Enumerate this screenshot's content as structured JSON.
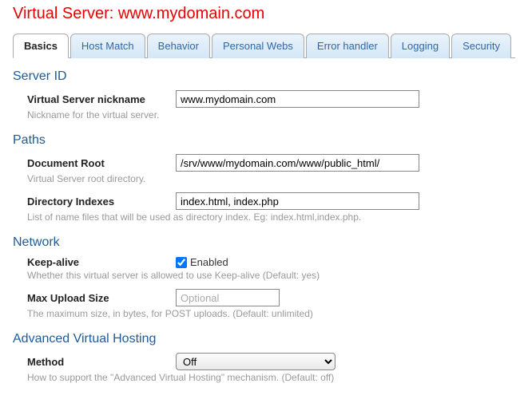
{
  "page_title": "Virtual Server: www.mydomain.com",
  "tabs": {
    "basics": "Basics",
    "host_match": "Host Match",
    "behavior": "Behavior",
    "personal_webs": "Personal Webs",
    "error_handler": "Error handler",
    "logging": "Logging",
    "security": "Security"
  },
  "sections": {
    "server_id": {
      "title": "Server ID",
      "nickname": {
        "label": "Virtual Server nickname",
        "value": "www.mydomain.com",
        "help": "Nickname for the virtual server."
      }
    },
    "paths": {
      "title": "Paths",
      "document_root": {
        "label": "Document Root",
        "value": "/srv/www/mydomain.com/www/public_html/",
        "help": "Virtual Server root directory."
      },
      "directory_indexes": {
        "label": "Directory Indexes",
        "value": "index.html, index.php",
        "help": "List of name files that will be used as directory index. Eg: index.html,index.php."
      }
    },
    "network": {
      "title": "Network",
      "keep_alive": {
        "label": "Keep-alive",
        "checkbox_label": "Enabled",
        "help": "Whether this virtual server is allowed to use Keep-alive (Default: yes)"
      },
      "max_upload": {
        "label": "Max Upload Size",
        "placeholder": "Optional",
        "help": "The maximum size, in bytes, for POST uploads. (Default: unlimited)"
      }
    },
    "adv_hosting": {
      "title": "Advanced Virtual Hosting",
      "method": {
        "label": "Method",
        "value": "Off",
        "help": "How to support the \"Advanced Virtual Hosting\" mechanism. (Default: off)"
      }
    }
  }
}
